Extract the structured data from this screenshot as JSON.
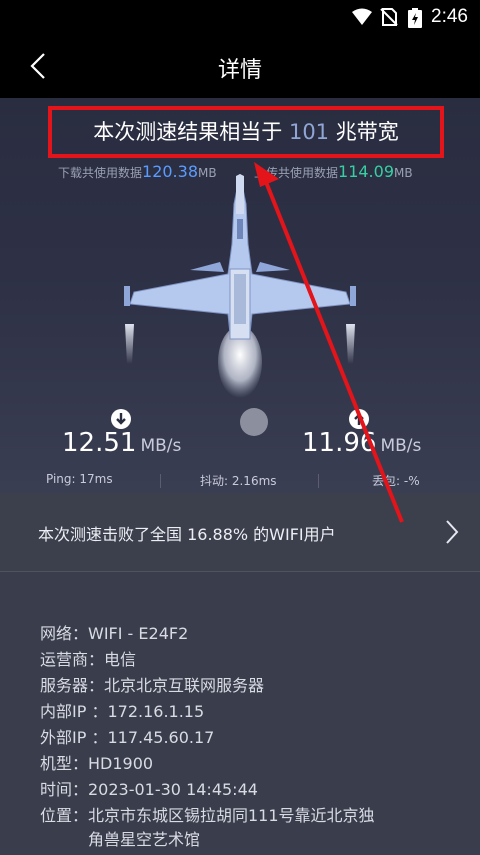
{
  "status_bar": {
    "time": "2:46"
  },
  "app_bar": {
    "title": "详情"
  },
  "result": {
    "prefix": "本次测速结果相当于",
    "value": "101",
    "suffix": "兆带宽"
  },
  "usage": {
    "download_label": "下载共使用数据",
    "download_value": "120.38",
    "download_unit": "MB",
    "upload_label": "上传共使用数据",
    "upload_value": "114.09",
    "upload_unit": "MB"
  },
  "speeds": {
    "download_value": "12.51",
    "download_unit": "MB/s",
    "upload_value": "11.96",
    "upload_unit": "MB/s"
  },
  "metrics": {
    "ping": "Ping:  17ms",
    "jitter": "抖动:  2.16ms",
    "loss": "丢包:  -%"
  },
  "beat": {
    "text": "本次测速击败了全国 16.88% 的WIFI用户"
  },
  "details": [
    "网络：WIFI - E24F2",
    "运营商：电信",
    "服务器：北京北京互联网服务器",
    "内部IP ：172.16.1.15",
    "外部IP ：117.45.60.17",
    "机型：HD1900",
    "时间：2023-01-30 14:45:44",
    "位置：北京市东城区锡拉胡同111号靠近北京独",
    "　　　角兽星空艺术馆"
  ],
  "colors": {
    "highlight": "#e3141a",
    "download": "#5a9cff",
    "upload": "#36d0a3",
    "background": "#232533"
  }
}
